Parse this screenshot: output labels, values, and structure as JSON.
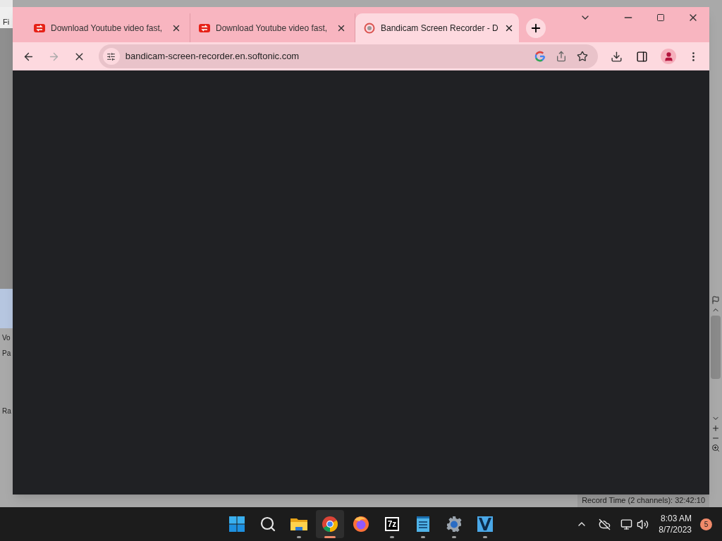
{
  "background_app": {
    "menu_label": "Fi",
    "labels": [
      "Vo",
      "Pa",
      "Ra"
    ],
    "status": "Record Time (2 channels): 32:42:10"
  },
  "browser": {
    "tabs": [
      {
        "title": "Download Youtube video fast,",
        "kind": "youtube",
        "selected": false
      },
      {
        "title": "Download Youtube video fast,",
        "kind": "youtube",
        "selected": false
      },
      {
        "title": "Bandicam Screen Recorder - D",
        "kind": "bandicam",
        "selected": true
      }
    ],
    "address": "bandicam-screen-recorder.en.softonic.com",
    "loading": true
  },
  "taskbar": {
    "apps": [
      {
        "kind": "start",
        "running": false,
        "selected": false
      },
      {
        "kind": "search",
        "running": false,
        "selected": false
      },
      {
        "kind": "folder",
        "running": true,
        "selected": false
      },
      {
        "kind": "chrome",
        "running": true,
        "selected": true
      },
      {
        "kind": "firefox",
        "running": false,
        "selected": false
      },
      {
        "kind": "archiver",
        "label": "7z",
        "running": true,
        "selected": false
      },
      {
        "kind": "notepad",
        "running": true,
        "selected": false
      },
      {
        "kind": "settings",
        "running": true,
        "selected": false
      },
      {
        "kind": "vegas",
        "running": true,
        "selected": false
      }
    ],
    "time": "8:03 AM",
    "date": "8/7/2023",
    "notifications": "5"
  }
}
